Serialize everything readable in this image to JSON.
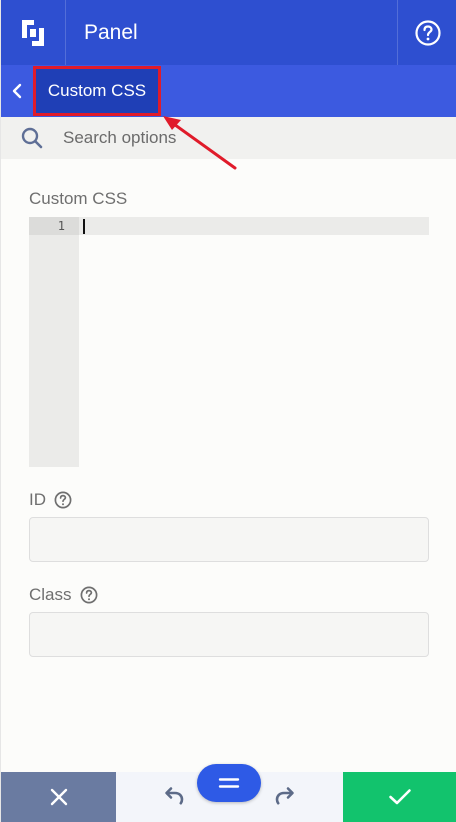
{
  "header": {
    "title": "Panel",
    "logo_icon": "builder-logo-icon",
    "help_icon": "question-circle-icon",
    "bg_color": "#2e4fd0"
  },
  "subheader": {
    "back_icon": "chevron-left-icon",
    "breadcrumb": "Custom CSS",
    "highlight_color": "#e01b2a"
  },
  "search": {
    "placeholder": "Search options",
    "value": "",
    "icon": "search-icon"
  },
  "fields": {
    "custom_css": {
      "label": "Custom CSS",
      "line_numbers": [
        "1"
      ],
      "value": ""
    },
    "id": {
      "label": "ID",
      "help_icon": "question-circle-icon",
      "value": ""
    },
    "class": {
      "label": "Class",
      "help_icon": "question-circle-icon",
      "value": ""
    }
  },
  "footer": {
    "close_icon": "close-icon",
    "undo_icon": "undo-icon",
    "menu_icon": "menu-icon",
    "redo_icon": "redo-icon",
    "save_icon": "checkmark-icon",
    "close_color": "#6a7ba1",
    "save_color": "#12c36d",
    "menu_color": "#2e5ae6"
  }
}
